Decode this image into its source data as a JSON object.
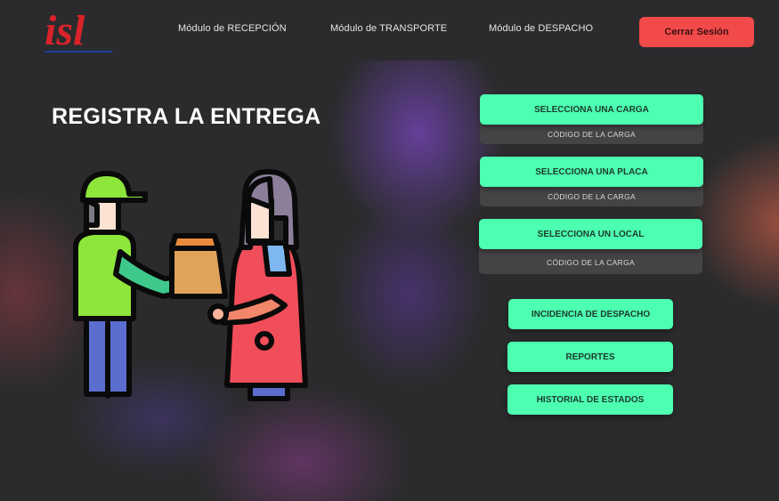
{
  "logo": {
    "text": "isl",
    "color_main": "#d8232a",
    "color_accent": "#1c3f9e"
  },
  "nav": {
    "links": [
      {
        "label": "Módulo de RECEPCIÓN"
      },
      {
        "label": "Módulo de TRANSPORTE"
      },
      {
        "label": "Módulo de DESPACHO"
      }
    ],
    "logout_label": "Cerrar Sesión"
  },
  "main": {
    "title": "REGISTRA LA ENTREGA",
    "illustration_icon": "delivery-person-handing-package-icon"
  },
  "selectors": [
    {
      "label": "SELECCIONA UNA CARGA",
      "sub": "CÓDIGO DE LA CARGA"
    },
    {
      "label": "SELECCIONA UNA PLACA",
      "sub": "CÓDIGO DE LA CARGA"
    },
    {
      "label": "SELECCIONA UN LOCAL",
      "sub": "CÓDIGO DE LA CARGA"
    }
  ],
  "actions": [
    {
      "label": "INCIDENCIA DE DESPACHO"
    },
    {
      "label": "REPORTES"
    },
    {
      "label": "HISTORIAL DE ESTADOS"
    }
  ],
  "colors": {
    "accent_green": "#4dffb0",
    "logout_red": "#f24a4a",
    "background": "#2b2b2d"
  }
}
